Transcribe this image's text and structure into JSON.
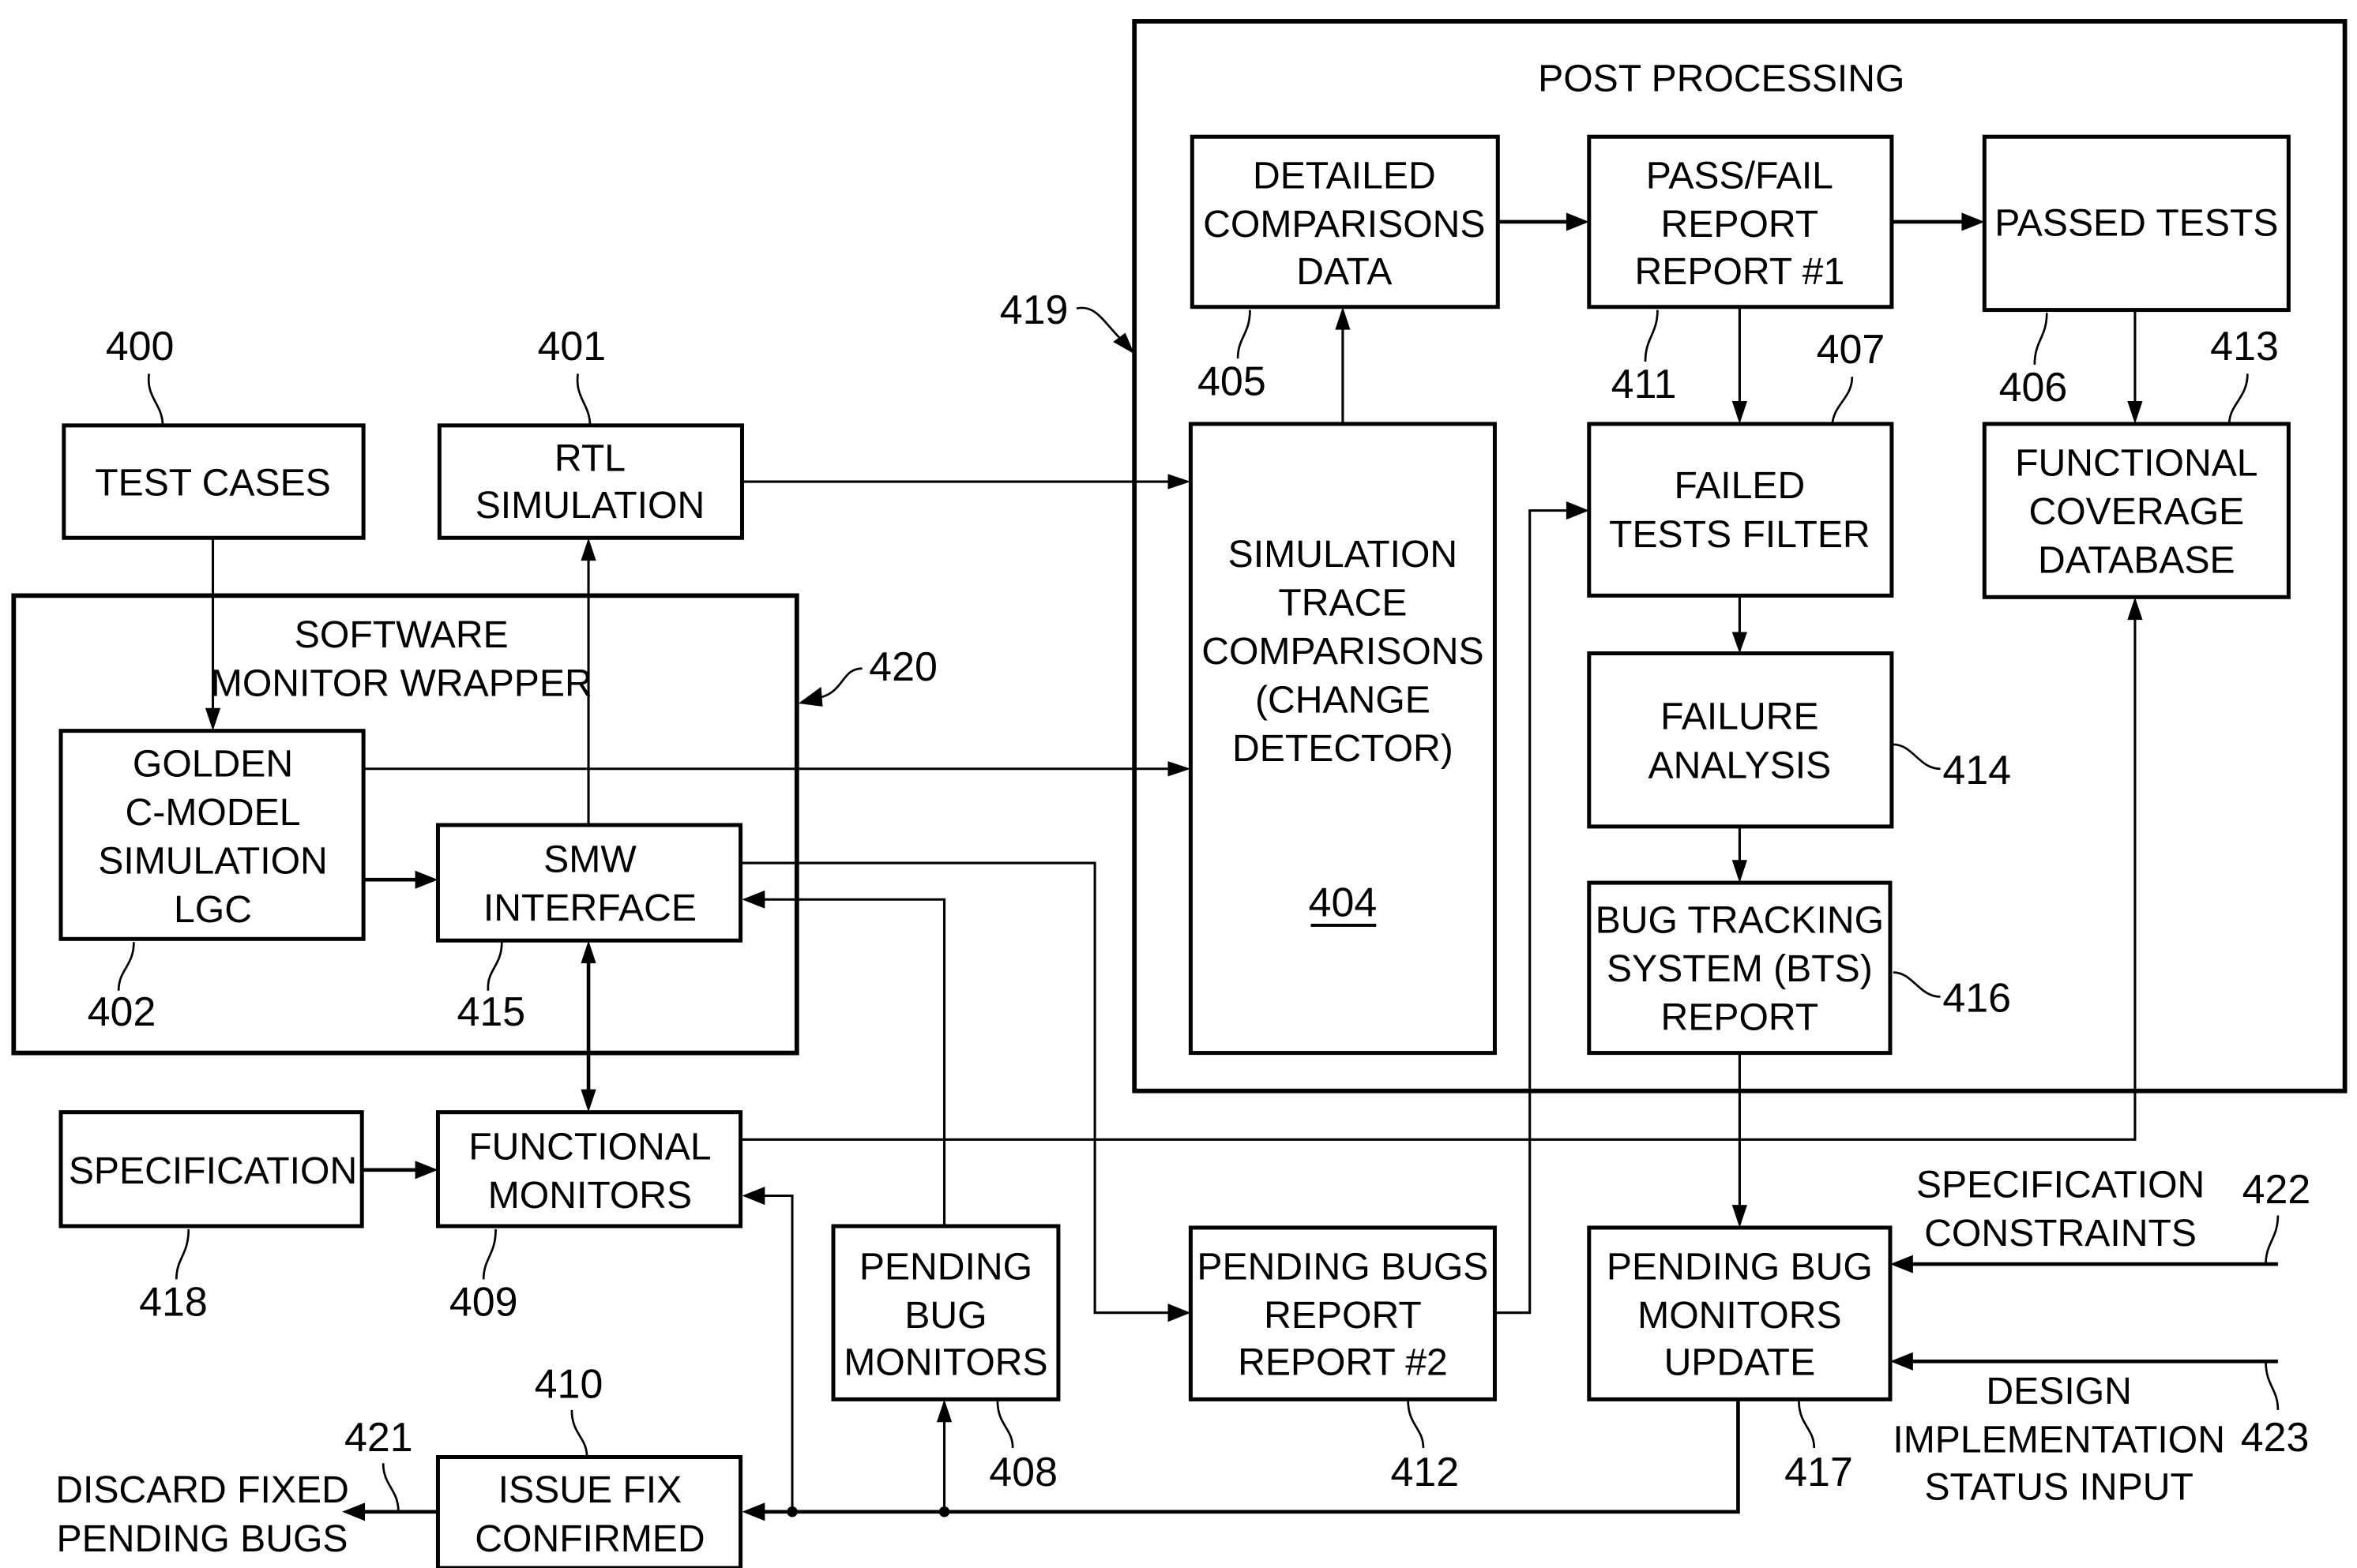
{
  "figure": {
    "post_processing": {
      "title": "POST PROCESSING",
      "ref": "419"
    },
    "software_monitor_wrapper": {
      "title_line1": "SOFTWARE",
      "title_line2": "MONITOR WRAPPER",
      "ref": "420"
    },
    "blocks": {
      "test_cases": {
        "lines": [
          "TEST CASES"
        ],
        "ref": "400"
      },
      "rtl_simulation": {
        "lines": [
          "RTL",
          "SIMULATION"
        ],
        "ref": "401"
      },
      "golden_c_model": {
        "lines": [
          "GOLDEN",
          "C-MODEL",
          "SIMULATION",
          "LGC"
        ],
        "ref": "402"
      },
      "smw_interface": {
        "lines": [
          "SMW",
          "INTERFACE"
        ],
        "ref": "415"
      },
      "specification": {
        "lines": [
          "SPECIFICATION"
        ],
        "ref": "418"
      },
      "functional_monitors": {
        "lines": [
          "FUNCTIONAL",
          "MONITORS"
        ],
        "ref": "409"
      },
      "issue_fix_confirmed": {
        "lines": [
          "ISSUE FIX",
          "CONFIRMED"
        ],
        "ref": "410"
      },
      "pending_bug_monitors": {
        "lines": [
          "PENDING",
          "BUG",
          "MONITORS"
        ],
        "ref": "408"
      },
      "simulation_trace": {
        "lines": [
          "SIMULATION",
          "TRACE",
          "COMPARISONS",
          "(CHANGE",
          "DETECTOR)"
        ],
        "ref": "404"
      },
      "detailed_comparisons": {
        "lines": [
          "DETAILED",
          "COMPARISONS",
          "DATA"
        ],
        "ref": "405"
      },
      "pass_fail_report": {
        "lines": [
          "PASS/FAIL",
          "REPORT",
          "REPORT #1"
        ],
        "ref": "411"
      },
      "passed_tests": {
        "lines": [
          "PASSED TESTS"
        ],
        "ref": "406"
      },
      "failed_tests_filter": {
        "lines": [
          "FAILED",
          "TESTS FILTER"
        ],
        "ref": "407"
      },
      "functional_coverage_db": {
        "lines": [
          "FUNCTIONAL",
          "COVERAGE",
          "DATABASE"
        ],
        "ref": "413"
      },
      "failure_analysis": {
        "lines": [
          "FAILURE",
          "ANALYSIS"
        ],
        "ref": "414"
      },
      "bts_report": {
        "lines": [
          "BUG TRACKING",
          "SYSTEM (BTS)",
          "REPORT"
        ],
        "ref": "416"
      },
      "pending_bugs_report": {
        "lines": [
          "PENDING BUGS",
          "REPORT",
          "REPORT #2"
        ],
        "ref": "412"
      },
      "pending_bug_monitors_update": {
        "lines": [
          "PENDING BUG",
          "MONITORS",
          "UPDATE"
        ],
        "ref": "417"
      }
    },
    "external": {
      "discard": {
        "lines": [
          "DISCARD FIXED",
          "PENDING BUGS"
        ],
        "ref": "421"
      },
      "spec_constraints": {
        "lines": [
          "SPECIFICATION",
          "CONSTRAINTS"
        ],
        "ref": "422"
      },
      "design_status": {
        "lines": [
          "DESIGN",
          "IMPLEMENTATION",
          "STATUS INPUT"
        ],
        "ref": "423"
      }
    }
  }
}
